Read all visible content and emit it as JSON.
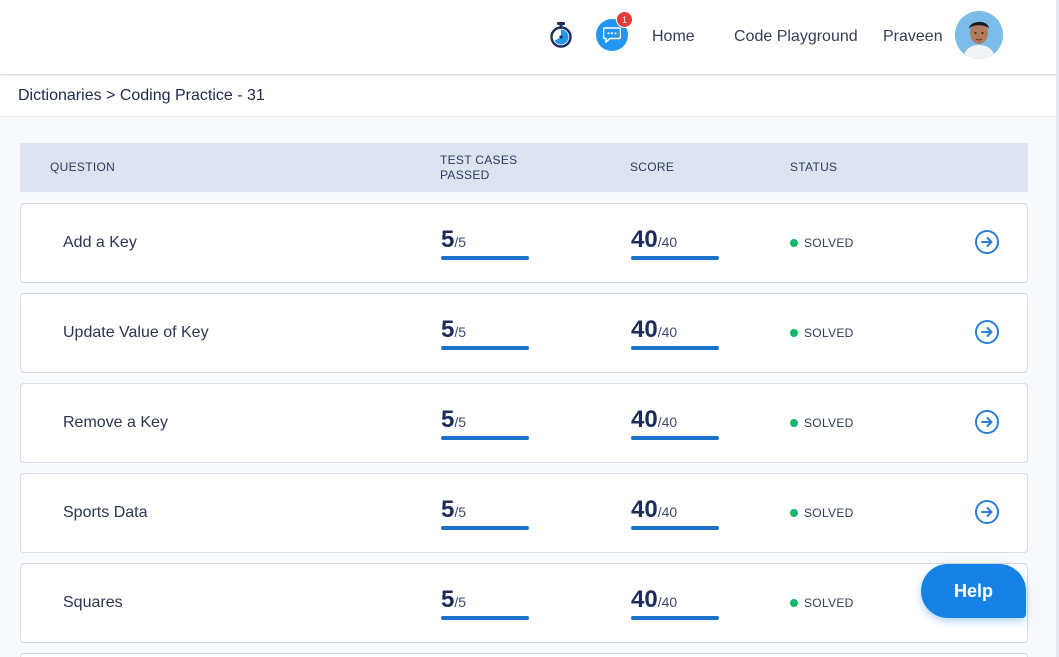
{
  "header": {
    "chat_badge_count": "1",
    "nav": [
      {
        "label": "Home"
      },
      {
        "label": "Code Playground"
      }
    ],
    "user_name": "Praveen",
    "icons": {
      "timer": "stopwatch-icon",
      "chat": "chat-bubble-icon",
      "avatar": "user-avatar"
    },
    "accent_color": "#2196f3"
  },
  "breadcrumb": "Dictionaries > Coding Practice - 31",
  "table": {
    "columns": [
      "QUESTION",
      "TEST CASES PASSED",
      "SCORE",
      "STATUS"
    ],
    "rows": [
      {
        "title": "Add a Key",
        "tests_passed": "5",
        "tests_total": "/5",
        "tests_fraction": 1.0,
        "score": "40",
        "score_total": "/40",
        "score_fraction": 1.0,
        "status": "SOLVED"
      },
      {
        "title": "Update Value of Key",
        "tests_passed": "5",
        "tests_total": "/5",
        "tests_fraction": 1.0,
        "score": "40",
        "score_total": "/40",
        "score_fraction": 1.0,
        "status": "SOLVED"
      },
      {
        "title": "Remove a Key",
        "tests_passed": "5",
        "tests_total": "/5",
        "tests_fraction": 1.0,
        "score": "40",
        "score_total": "/40",
        "score_fraction": 1.0,
        "status": "SOLVED"
      },
      {
        "title": "Sports Data",
        "tests_passed": "5",
        "tests_total": "/5",
        "tests_fraction": 1.0,
        "score": "40",
        "score_total": "/40",
        "score_fraction": 1.0,
        "status": "SOLVED"
      },
      {
        "title": "Squares",
        "tests_passed": "5",
        "tests_total": "/5",
        "tests_fraction": 1.0,
        "score": "40",
        "score_total": "/40",
        "score_fraction": 1.0,
        "status": "SOLVED"
      }
    ],
    "status_color": "#12b76a",
    "bar_color": "#1a73c8"
  },
  "help_button": {
    "label": "Help",
    "color": "#1682e6"
  }
}
